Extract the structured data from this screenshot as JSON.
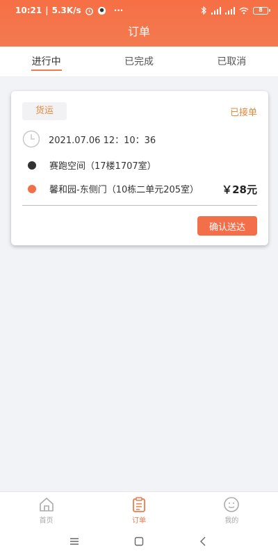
{
  "status_bar": {
    "time": "10:21",
    "net_speed": "5.3K/s",
    "more": "···",
    "battery": "8"
  },
  "header": {
    "title": "订单"
  },
  "tabs": [
    {
      "label": "进行中",
      "active": true
    },
    {
      "label": "已完成",
      "active": false
    },
    {
      "label": "已取消",
      "active": false
    }
  ],
  "order": {
    "type": "货运",
    "status": "已接单",
    "datetime": "2021.07.06 12：10：36",
    "pickup": "赛跑空间（17楼1707室）",
    "dropoff": "馨和园-东侧门（10栋二单元205室）",
    "price": "￥28元",
    "confirm_label": "确认送达"
  },
  "bottom_nav": [
    {
      "label": "首页",
      "icon": "home-icon",
      "active": false
    },
    {
      "label": "订单",
      "icon": "clipboard-icon",
      "active": true
    },
    {
      "label": "我的",
      "icon": "user-icon",
      "active": false
    }
  ],
  "colors": {
    "accent": "#f26f4a",
    "badge_text": "#e08a3c",
    "pickup_dot": "#333333",
    "dropoff_dot": "#f26f4a"
  }
}
